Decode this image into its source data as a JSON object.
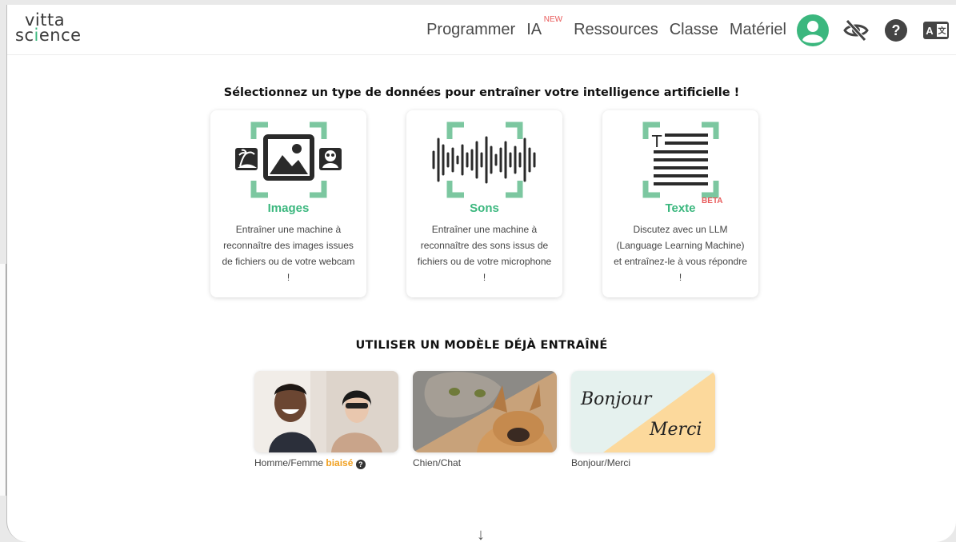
{
  "logo": {
    "line1": "vitta",
    "line2_a": "sc",
    "line2_b": "i",
    "line2_c": "ence"
  },
  "nav": {
    "programmer": "Programmer",
    "ia": "IA",
    "ia_badge": "NEW",
    "ressources": "Ressources",
    "classe": "Classe",
    "materiel": "Matériel",
    "icons": [
      "user-avatar-icon",
      "accessibility-eye-icon",
      "help-icon",
      "language-icon"
    ]
  },
  "main": {
    "title": "Sélectionnez un type de données pour entraîner votre intelligence artificielle !",
    "cards": [
      {
        "title": "Images",
        "badge": "",
        "description": "Entraîner une machine à reconnaître des images issues de fichiers ou de votre webcam !"
      },
      {
        "title": "Sons",
        "badge": "",
        "description": "Entraîner une machine à reconnaître des sons issus de fichiers ou de votre microphone !"
      },
      {
        "title": "Texte",
        "badge": "BETA",
        "description": "Discutez avec un LLM (Language Learning Machine) et entraînez-le à vous répondre !"
      }
    ],
    "pretrained_title": "UTILISER UN MODÈLE DÉJÀ ENTRAÎNÉ",
    "models": [
      {
        "caption": "Homme/Femme",
        "tag": "biaisé",
        "help": "?"
      },
      {
        "caption": "Chien/Chat"
      },
      {
        "caption": "Bonjour/Merci",
        "image_text_1": "Bonjour",
        "image_text_2": "Merci"
      }
    ],
    "scroll_arrow": "↓"
  },
  "colors": {
    "accent": "#3bb77e",
    "badge": "#e85a5a",
    "biased": "#f0a020",
    "frame_green": "#7cc7a0"
  }
}
